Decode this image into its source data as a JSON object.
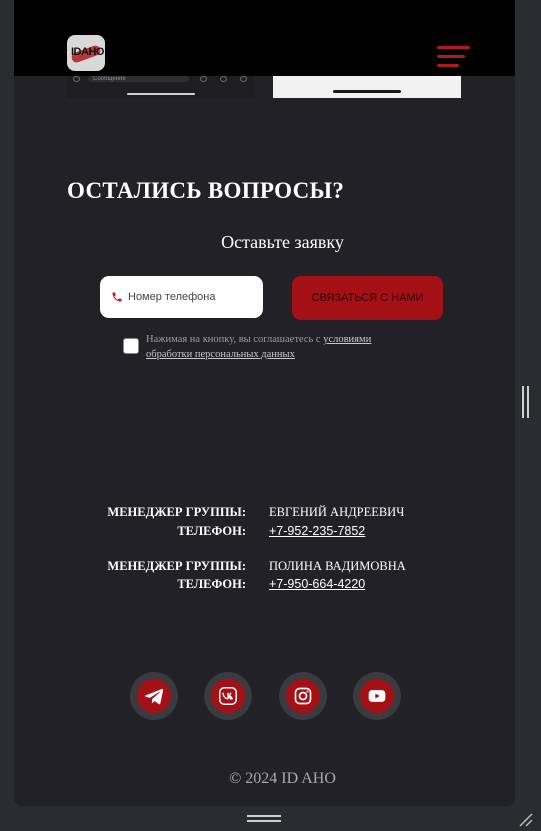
{
  "header": {
    "logo_text": "IDAHO",
    "menu_icon": "hamburger-menu-icon"
  },
  "preview": {
    "message_placeholder": "Сообщение"
  },
  "form": {
    "title": "ОСТАЛИСЬ ВОПРОСЫ?",
    "subtitle": "Оставьте заявку",
    "phone_placeholder": "Номер телефона",
    "submit_label": "СВЯЗАТЬСЯ С НАМИ",
    "consent_prefix": "Нажимая на кнопку, вы соглашаетесь с ",
    "consent_link": "условиями обработки персональных данных",
    "consent_checked": false
  },
  "contacts": [
    {
      "role_label": "МЕНЕДЖЕР ГРУППЫ:",
      "name": "ЕВГЕНИЙ АНДРЕЕВИЧ",
      "phone_label": "ТЕЛЕФОН:",
      "phone": "+7-952-235-7852"
    },
    {
      "role_label": "МЕНЕДЖЕР ГРУППЫ:",
      "name": "ПОЛИНА ВАДИМОВНА",
      "phone_label": "ТЕЛЕФОН:",
      "phone": "+7-950-664-4220"
    }
  ],
  "socials": [
    "telegram-icon",
    "vk-icon",
    "instagram-icon",
    "youtube-icon"
  ],
  "footer": {
    "copyright": "© 2024 ID AHO"
  },
  "colors": {
    "accent": "#a51017",
    "background": "#212126",
    "header": "#000000"
  }
}
